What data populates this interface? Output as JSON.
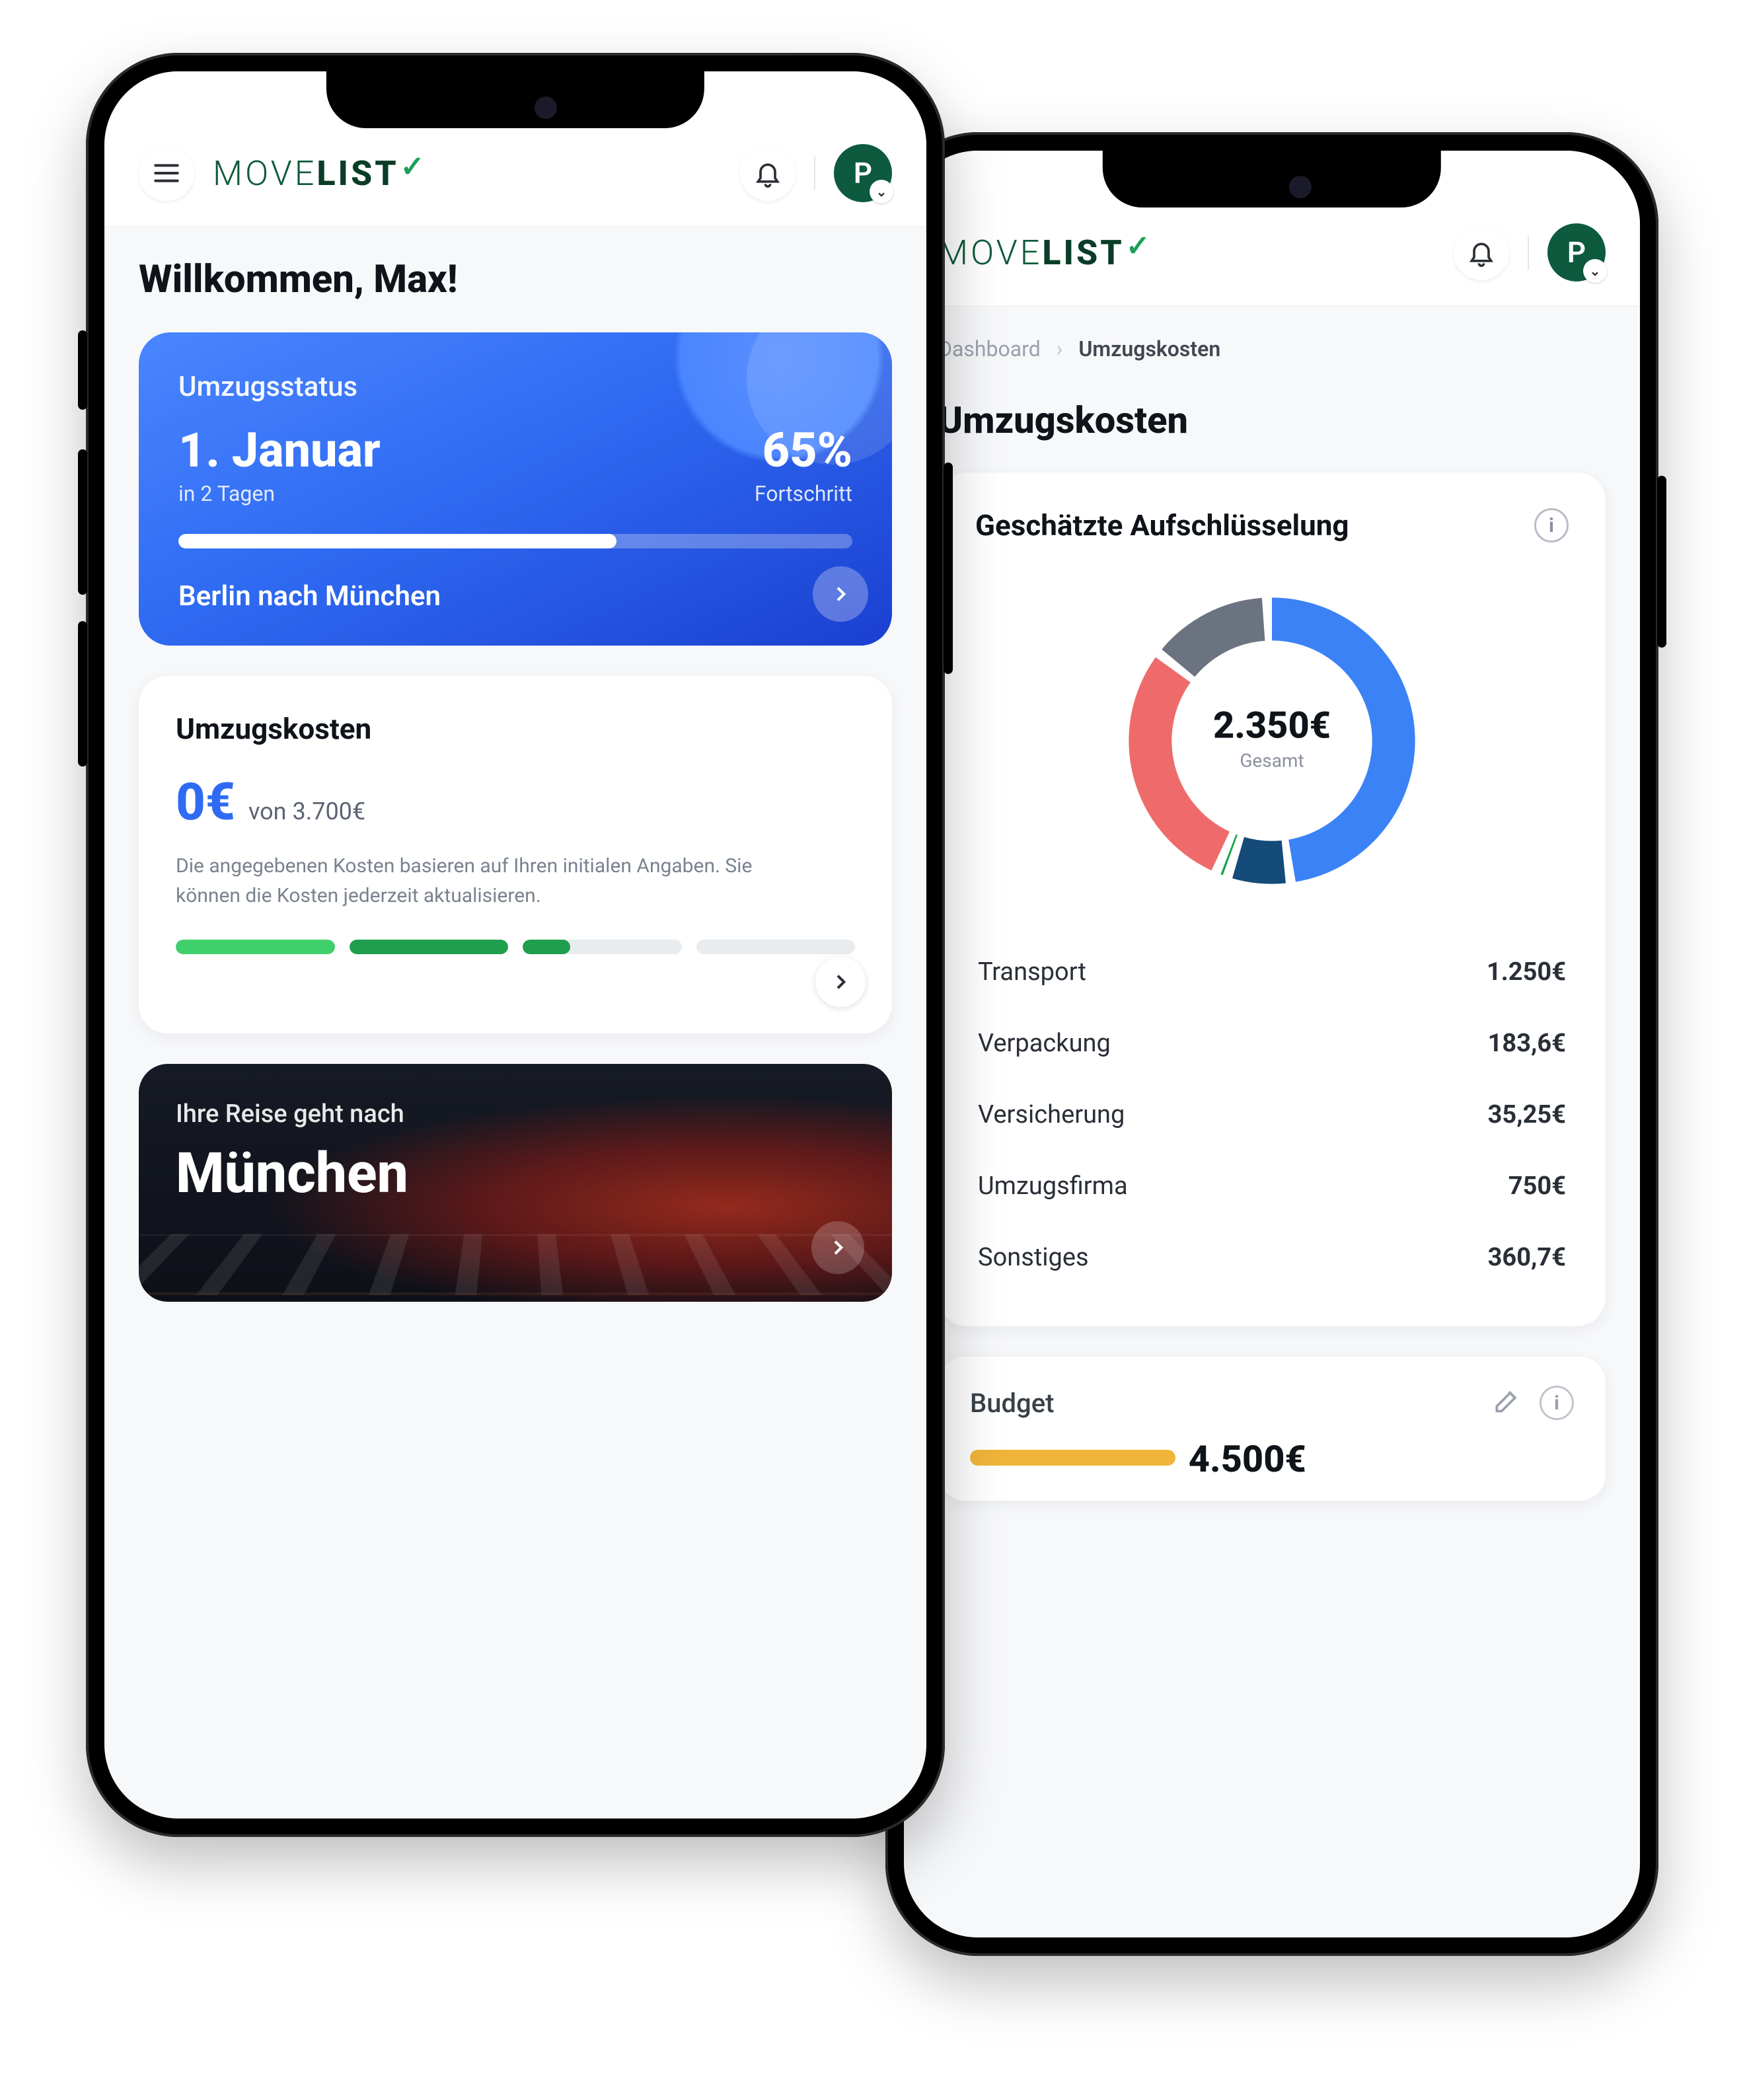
{
  "brand": {
    "thin": "MOVE",
    "bold": "LIST"
  },
  "avatar_initial": "P",
  "front": {
    "welcome": "Willkommen, Max!",
    "status": {
      "title": "Umzugsstatus",
      "date": "1. Januar",
      "days": "in 2 Tagen",
      "percent": "65%",
      "percent_label": "Fortschritt",
      "progress_pct": 65,
      "route": "Berlin nach München"
    },
    "costs": {
      "title": "Umzugskosten",
      "amount": "0€",
      "of": "von 3.700€",
      "note": "Die angegebenen Kosten basieren auf Ihren initialen Angaben. Sie können die Kosten jederzeit aktualisieren.",
      "segments": [
        {
          "color": "#3fcf6b",
          "fill_pct": 100
        },
        {
          "color": "#1f9e4d",
          "fill_pct": 100
        },
        {
          "color": "#1f9e4d",
          "fill_pct": 30
        },
        {
          "color": "#e9ecef",
          "fill_pct": 0
        }
      ]
    },
    "destination": {
      "subtitle": "Ihre Reise geht nach",
      "city": "München"
    }
  },
  "back": {
    "breadcrumb_prev": "Dashboard",
    "breadcrumb_current": "Umzugskosten",
    "page_title": "Umzugskosten",
    "breakdown_card_title": "Geschätzte Aufschlüsselung",
    "total_value": "2.350€",
    "total_label": "Gesamt",
    "rows": [
      {
        "label": "Transport",
        "value": "1.250€"
      },
      {
        "label": "Verpackung",
        "value": "183,6€"
      },
      {
        "label": "Versicherung",
        "value": "35,25€"
      },
      {
        "label": "Umzugsfirma",
        "value": "750€"
      },
      {
        "label": "Sonstiges",
        "value": "360,7€"
      }
    ],
    "budget_title": "Budget",
    "budget_amount": "4.500€"
  },
  "chart_data": {
    "type": "pie",
    "title": "Geschätzte Aufschlüsselung",
    "total": 2350,
    "currency": "€",
    "series": [
      {
        "name": "Transport",
        "value": 1250,
        "color": "#3b82f6"
      },
      {
        "name": "Verpackung",
        "value": 183.6,
        "color": "#144b78"
      },
      {
        "name": "Versicherung",
        "value": 35.25,
        "color": "#16a34a"
      },
      {
        "name": "Umzugsfirma",
        "value": 750,
        "color": "#ef6b6b"
      },
      {
        "name": "Sonstiges",
        "value": 360.7,
        "color": "#6b7280"
      }
    ]
  }
}
